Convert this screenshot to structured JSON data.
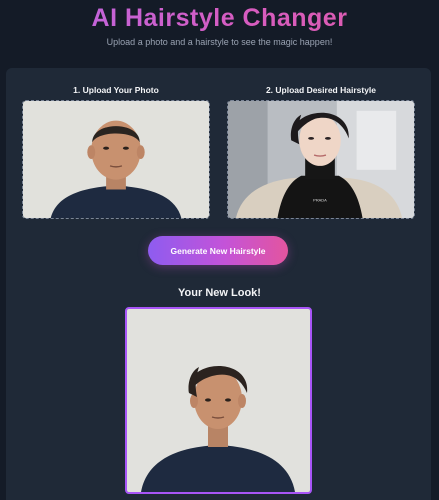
{
  "header": {
    "title": "AI Hairstyle Changer",
    "subtitle": "Upload a photo and a hairstyle to see the magic happen!"
  },
  "uploads": {
    "photo_label": "1. Upload Your Photo",
    "hairstyle_label": "2. Upload Desired Hairstyle"
  },
  "actions": {
    "generate_label": "Generate New Hairstyle"
  },
  "result": {
    "title": "Your New Look!"
  },
  "colors": {
    "background": "#141b27",
    "panel": "#1f2937",
    "accent_purple": "#a855f7",
    "accent_pink": "#e3559f"
  }
}
